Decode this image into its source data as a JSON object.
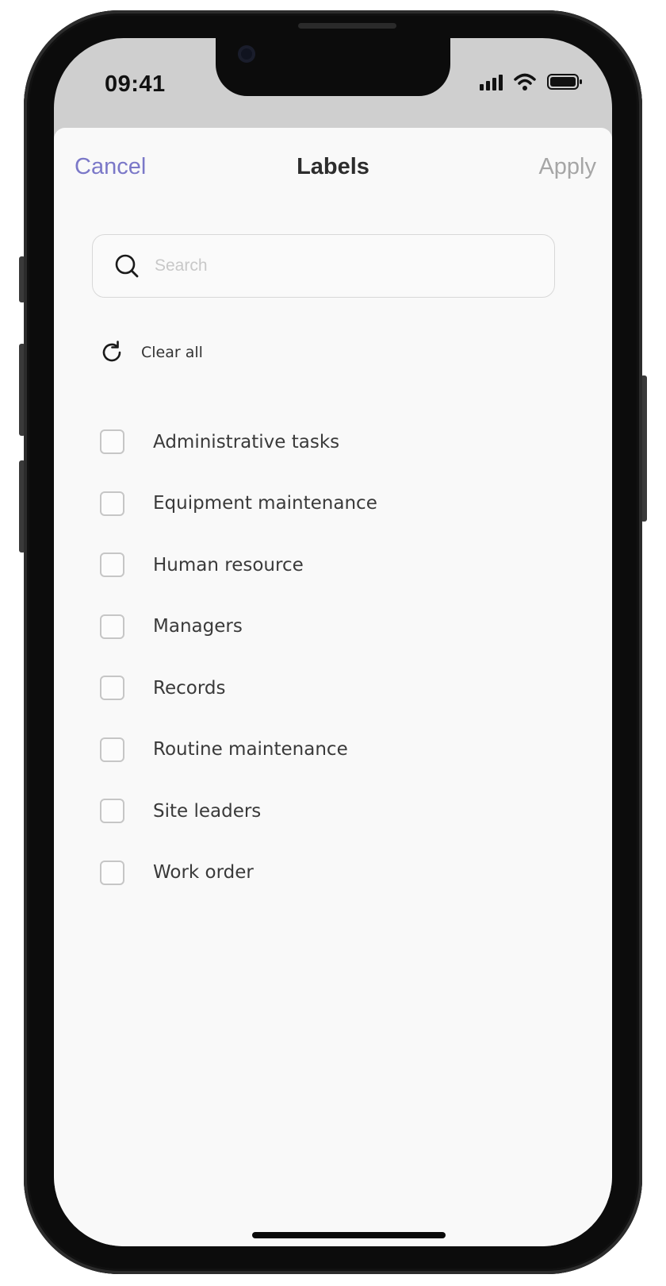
{
  "status_bar": {
    "time": "09:41"
  },
  "nav": {
    "cancel": "Cancel",
    "title": "Labels",
    "apply": "Apply"
  },
  "search": {
    "placeholder": "Search",
    "value": ""
  },
  "clear_all": "Clear all",
  "labels": [
    {
      "text": "Administrative tasks",
      "checked": false
    },
    {
      "text": "Equipment maintenance",
      "checked": false
    },
    {
      "text": "Human resource",
      "checked": false
    },
    {
      "text": "Managers",
      "checked": false
    },
    {
      "text": "Records",
      "checked": false
    },
    {
      "text": "Routine maintenance",
      "checked": false
    },
    {
      "text": "Site leaders",
      "checked": false
    },
    {
      "text": "Work order",
      "checked": false
    }
  ],
  "colors": {
    "accent": "#7b78c8",
    "apply_disabled": "#a6a6a6",
    "sheet_background": "#f9f9f9"
  }
}
